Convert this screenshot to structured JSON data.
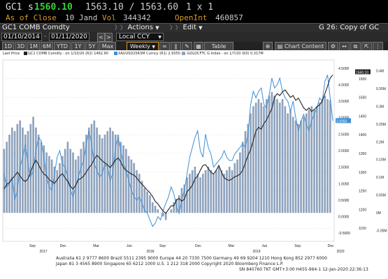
{
  "quote": {
    "ticker": "GC1",
    "last_prefix": "s",
    "last": "1560.10",
    "bid_ask": "1563.10 / 1563.60",
    "size": "1 x 1",
    "asof_label": "As of Close",
    "asof_date": "10 Jand",
    "vol_label": "Vol",
    "vol": "344342",
    "oi_label": "OpenInt",
    "oi": "460857"
  },
  "toolbar": {
    "security": "GC1 COMB Comdty",
    "actions": "Actions",
    "edit": "Edit",
    "page_title": "G 26: Copy of GC",
    "date_from": "01/10/2014",
    "date_to": "01/11/2020",
    "currency": "Local CCY",
    "periods": [
      "1D",
      "3D",
      "1M",
      "6M",
      "YTD",
      "1Y",
      "5Y",
      "Max"
    ],
    "frequency": "Weekly",
    "table": "Table",
    "chart_content": "Chart Content"
  },
  "legend": {
    "last_price": "Last Price",
    "items": [
      {
        "label": "GC1 COMB Comdty - on 1/10/20 (R2) 1462.90",
        "color": "#222222"
      },
      {
        "label": "XAUUSD25R3M Curncy (R1) 2.9350",
        "color": "#3d8fd6"
      },
      {
        "label": ".GOLDCFTC G Index - on 1/7/20 (R3) 0.317M",
        "color": "#8ea2bd"
      }
    ]
  },
  "colors": {
    "gold_price": "#222222",
    "risk_reversal": "#3d8fd6",
    "cftc_bars": "#8ea2bd"
  },
  "chart_data": {
    "type": "bar",
    "x_labels": [
      "Sep",
      "Dec",
      "Mar",
      "Jun",
      "Sep",
      "Dec",
      "Mar",
      "Jun",
      "Sep",
      "Dec"
    ],
    "year_labels": [
      "2017",
      "2018",
      "2019",
      "2020"
    ],
    "axis_r1": {
      "ticks": [
        "4.5000",
        "4.0000",
        "3.5000",
        "3.0000",
        "2.5000",
        "2.0000",
        "1.5000",
        "1.0000",
        "0.5000",
        "0.0000",
        "-0.5000"
      ],
      "range": [
        -0.75,
        4.75
      ]
    },
    "axis_r2": {
      "ticks": [
        "1550",
        "1500",
        "1450",
        "1400",
        "1350",
        "1300",
        "1250",
        "1200",
        "1150"
      ],
      "range": [
        1115,
        1600
      ]
    },
    "axis_r3": {
      "ticks": [
        "0.4M",
        "0.35M",
        "0.3M",
        "0.25M",
        "0.2M",
        "0.15M",
        "0.1M",
        "0.05M",
        "0M",
        "-0.05M"
      ],
      "range": [
        -0.08,
        0.43
      ]
    },
    "last_labels": {
      "r2": "1560.10",
      "r3": "0.317M",
      "r1": "2.9350"
    },
    "series": [
      {
        "name": "GC1 COMB Comdty",
        "axis": "R2",
        "values": [
          1255,
          1268,
          1272,
          1282,
          1290,
          1300,
          1290,
          1280,
          1275,
          1282,
          1300,
          1320,
          1332,
          1320,
          1305,
          1295,
          1290,
          1280,
          1275,
          1270,
          1280,
          1290,
          1296,
          1285,
          1275,
          1262,
          1255,
          1265,
          1280,
          1283,
          1290,
          1300,
          1312,
          1320,
          1335,
          1345,
          1338,
          1330,
          1325,
          1320,
          1312,
          1322,
          1332,
          1338,
          1328,
          1312,
          1305,
          1300,
          1295,
          1292,
          1285,
          1275,
          1268,
          1260,
          1252,
          1245,
          1235,
          1222,
          1215,
          1205,
          1196,
          1190,
          1200,
          1210,
          1210,
          1225,
          1230,
          1222,
          1228,
          1248,
          1255,
          1265,
          1282,
          1290,
          1305,
          1318,
          1320,
          1310,
          1300,
          1295,
          1305,
          1318,
          1300,
          1285,
          1280,
          1278,
          1282,
          1288,
          1290,
          1295,
          1305,
          1325,
          1345,
          1360,
          1385,
          1410,
          1420,
          1415,
          1430,
          1440,
          1455,
          1470,
          1500,
          1510,
          1505,
          1515,
          1520,
          1510,
          1500,
          1505,
          1492,
          1498,
          1485,
          1472,
          1465,
          1472,
          1462,
          1468,
          1475,
          1480,
          1490,
          1510,
          1530,
          1552,
          1560
        ]
      },
      {
        "name": "XAUUSD25R3M Curncy",
        "axis": "R1",
        "values": [
          1.3,
          0.9,
          1.0,
          1.2,
          0.5,
          0.8,
          1.5,
          1.8,
          2.2,
          1.6,
          1.2,
          1.4,
          2.0,
          2.4,
          2.3,
          1.8,
          1.2,
          0.9,
          0.8,
          1.3,
          1.8,
          2.0,
          1.6,
          1.5,
          1.2,
          0.8,
          0.6,
          0.9,
          1.2,
          1.5,
          1.7,
          2.2,
          2.6,
          2.2,
          1.6,
          1.4,
          1.2,
          1.3,
          1.6,
          1.5,
          1.1,
          1.3,
          2.1,
          2.4,
          2.0,
          1.6,
          1.4,
          1.1,
          0.8,
          0.6,
          0.5,
          0.6,
          0.4,
          0.2,
          0.1,
          -0.1,
          -0.3,
          -0.2,
          0.0,
          -0.1,
          0.2,
          0.4,
          0.6,
          0.9,
          0.7,
          0.3,
          0.1,
          0.5,
          0.8,
          1.3,
          1.8,
          2.1,
          2.4,
          2.6,
          2.0,
          1.8,
          2.5,
          2.1,
          1.9,
          1.5,
          1.6,
          1.7,
          1.8,
          2.0,
          1.8,
          1.7,
          1.7,
          1.9,
          2.0,
          2.1,
          2.2,
          2.1,
          2.5,
          3.4,
          3.8,
          3.6,
          3.8,
          3.9,
          3.4,
          3.3,
          3.7,
          4.2,
          3.9,
          4.0,
          4.2,
          3.8,
          3.6,
          3.5,
          3.2,
          3.5,
          3.0,
          2.6,
          2.9,
          3.1,
          2.8,
          2.6,
          2.9,
          3.1,
          3.3,
          3.6,
          3.5,
          4.1,
          4.3,
          3.6,
          2.9
        ]
      },
      {
        "name": ".GOLDCFTC G Index",
        "axis": "R3",
        "values": [
          0.18,
          0.2,
          0.22,
          0.24,
          0.23,
          0.25,
          0.26,
          0.24,
          0.22,
          0.23,
          0.25,
          0.27,
          0.24,
          0.22,
          0.2,
          0.19,
          0.17,
          0.16,
          0.15,
          0.13,
          0.12,
          0.14,
          0.16,
          0.18,
          0.2,
          0.18,
          0.17,
          0.15,
          0.16,
          0.18,
          0.2,
          0.22,
          0.24,
          0.25,
          0.26,
          0.24,
          0.22,
          0.21,
          0.22,
          0.23,
          0.24,
          0.23,
          0.22,
          0.22,
          0.2,
          0.19,
          0.18,
          0.16,
          0.15,
          0.14,
          0.12,
          0.11,
          0.09,
          0.07,
          0.06,
          0.05,
          0.03,
          0.02,
          0.01,
          0.0,
          -0.01,
          -0.02,
          0.0,
          0.01,
          0.03,
          0.04,
          0.05,
          0.07,
          0.08,
          0.1,
          0.11,
          0.12,
          0.13,
          0.11,
          0.1,
          0.11,
          0.12,
          0.13,
          0.12,
          0.11,
          0.12,
          0.13,
          0.12,
          0.11,
          0.12,
          0.13,
          0.12,
          0.14,
          0.15,
          0.17,
          0.2,
          0.23,
          0.25,
          0.28,
          0.3,
          0.31,
          0.32,
          0.31,
          0.3,
          0.32,
          0.33,
          0.34,
          0.33,
          0.32,
          0.31,
          0.32,
          0.3,
          0.28,
          0.29,
          0.27,
          0.26,
          0.25,
          0.26,
          0.27,
          0.28,
          0.29,
          0.3,
          0.29,
          0.3,
          0.31,
          0.32,
          0.33,
          0.32,
          0.317
        ]
      }
    ]
  },
  "footer": {
    "line1": "Australia 61 2 9777 8600 Brazil 5511 2395 9000 Europe 44 20 7330 7500 Germany 49 69 9204 1210 Hong Kong 852 2977 6000",
    "line2": "Japan 81 3 4565 8900        Singapore 65 6212 1000        U.S. 1 212 318 2000          Copyright 2020 Bloomberg Finance L.P.",
    "line3": "SN 840760 TKT  GMT+3:00 H455-964-1 12-Jan-2020 22:36:13"
  }
}
